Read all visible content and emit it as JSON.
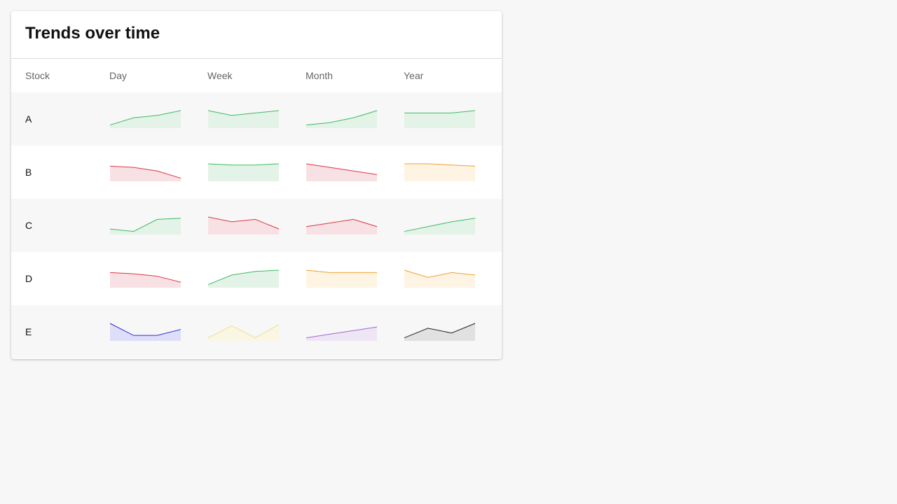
{
  "title": "Trends over time",
  "columns": [
    "Stock",
    "Day",
    "Week",
    "Month",
    "Year"
  ],
  "colors": {
    "up": "#3dbb61",
    "up_fill": "#e3f3e7",
    "down": "#dc3545",
    "down_fill": "#f8e1e5",
    "flat": "#f0a030",
    "flat_fill": "#fdf4e4",
    "blue": "#2e2ed6",
    "blue_fill": "#dedef9",
    "yellow": "#efdf8a",
    "yellow_fill": "#faf6e4",
    "purple": "#a066cc",
    "purple_fill": "#efe6f5",
    "black": "#222222",
    "black_fill": "#e1e1e1"
  },
  "chart_data": {
    "type": "table",
    "title": "Trends over time",
    "columns": [
      "Stock",
      "Day",
      "Week",
      "Month",
      "Year"
    ],
    "rows": [
      {
        "stock": "A",
        "sparklines": [
          {
            "period": "Day",
            "values": [
              1,
              4,
              5,
              7
            ],
            "color": "up"
          },
          {
            "period": "Week",
            "values": [
              7,
              5,
              6,
              7
            ],
            "color": "up"
          },
          {
            "period": "Month",
            "values": [
              1,
              2,
              4,
              7
            ],
            "color": "up"
          },
          {
            "period": "Year",
            "values": [
              6,
              6,
              6,
              7
            ],
            "color": "up"
          }
        ]
      },
      {
        "stock": "B",
        "sparklines": [
          {
            "period": "Day",
            "values": [
              6,
              5.5,
              4,
              1
            ],
            "color": "down"
          },
          {
            "period": "Week",
            "values": [
              7,
              6.5,
              6.5,
              7
            ],
            "color": "up"
          },
          {
            "period": "Month",
            "values": [
              7,
              5.5,
              4,
              2.5
            ],
            "color": "down"
          },
          {
            "period": "Year",
            "values": [
              7,
              7,
              6.5,
              6
            ],
            "color": "flat"
          }
        ]
      },
      {
        "stock": "C",
        "sparklines": [
          {
            "period": "Day",
            "values": [
              2,
              1,
              6,
              6.5
            ],
            "color": "up"
          },
          {
            "period": "Week",
            "values": [
              7,
              5,
              6,
              2
            ],
            "color": "down"
          },
          {
            "period": "Month",
            "values": [
              3,
              4.5,
              6,
              3
            ],
            "color": "down"
          },
          {
            "period": "Year",
            "values": [
              1,
              3,
              5,
              6.5
            ],
            "color": "up"
          }
        ]
      },
      {
        "stock": "D",
        "sparklines": [
          {
            "period": "Day",
            "values": [
              6,
              5.5,
              4.5,
              2
            ],
            "color": "down"
          },
          {
            "period": "Week",
            "values": [
              1,
              5,
              6.5,
              7
            ],
            "color": "up"
          },
          {
            "period": "Month",
            "values": [
              7,
              6,
              6,
              6
            ],
            "color": "flat"
          },
          {
            "period": "Year",
            "values": [
              7,
              4,
              6,
              5
            ],
            "color": "flat"
          }
        ]
      },
      {
        "stock": "E",
        "sparklines": [
          {
            "period": "Day",
            "values": [
              7,
              2,
              2,
              4.5
            ],
            "color": "blue"
          },
          {
            "period": "Week",
            "values": [
              1,
              6,
              1,
              6.5
            ],
            "color": "yellow"
          },
          {
            "period": "Month",
            "values": [
              1,
              2.5,
              4,
              5.5
            ],
            "color": "purple"
          },
          {
            "period": "Year",
            "values": [
              1,
              5,
              3,
              7
            ],
            "color": "black"
          }
        ]
      }
    ],
    "value_range": [
      0,
      7
    ]
  }
}
